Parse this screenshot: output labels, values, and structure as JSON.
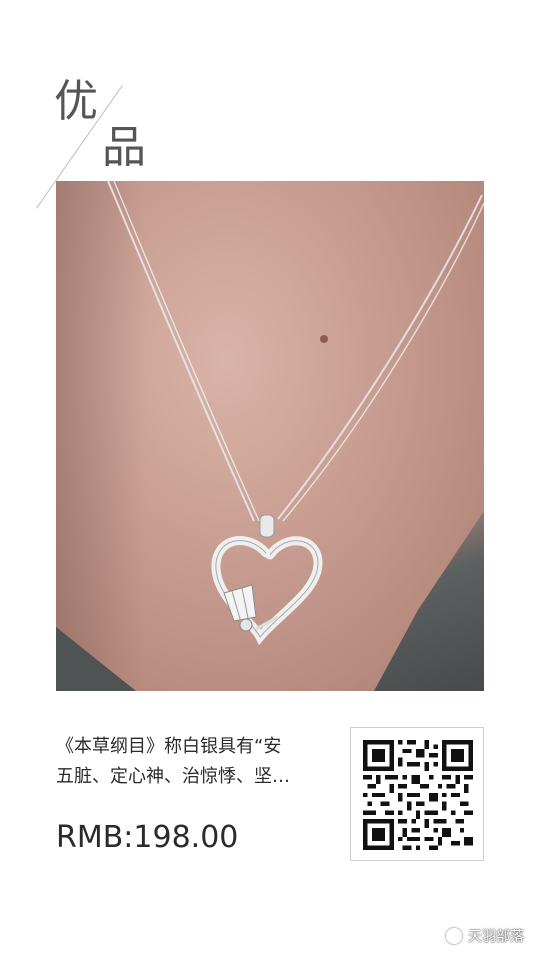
{
  "brand": {
    "char1": "优",
    "char2": "品"
  },
  "product": {
    "description_line1": "《本草纲目》称白银具有“安",
    "description_line2": "五脏、定心神、治惊悸、坚…",
    "price": "RMB:198.00"
  },
  "watermark": {
    "text": "天羽部落",
    "icon": "wechat-channel-icon"
  },
  "colors": {
    "text": "#2b2b2b",
    "brand_text": "#555555",
    "qr_border": "#cfcfcf"
  }
}
